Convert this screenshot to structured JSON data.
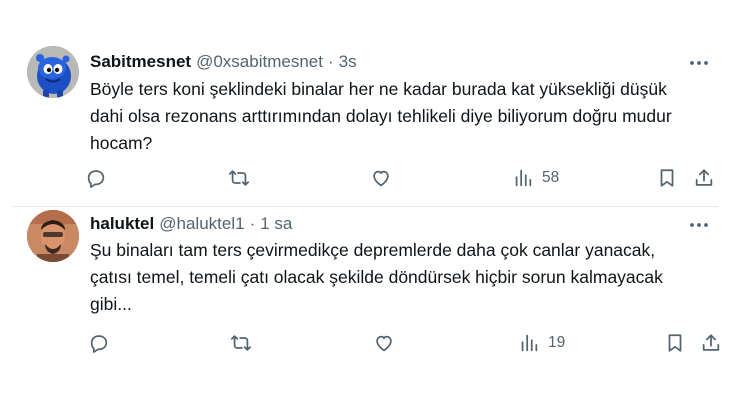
{
  "tweets": [
    {
      "name": "Sabitmesnet",
      "handle": "@0xsabitmesnet",
      "separator": "·",
      "time": "3s",
      "text_lines": [
        "Böyle ters koni şeklindeki binalar her ne kadar burada kat yüksekliği düşük",
        "dahi olsa rezonans arttırımından dolayı tehlikeli diye biliyorum doğru mudur",
        "hocam?"
      ],
      "views": "58",
      "icons": [
        "reply-icon",
        "retweet-icon",
        "like-icon",
        "views-icon",
        "bookmark-icon",
        "share-icon",
        "more-icon"
      ]
    },
    {
      "name": "haluktel",
      "handle": "@haluktel1",
      "separator": "·",
      "time": "1 sa",
      "text_lines": [
        "Şu binaları tam ters çevirmedikçe depremlerde daha çok canlar yanacak,",
        "çatısı temel, temeli çatı olacak şekilde döndürsek hiçbir sorun kalmayacak",
        "gibi..."
      ],
      "views": "19",
      "icons": [
        "reply-icon",
        "retweet-icon",
        "like-icon",
        "views-icon",
        "bookmark-icon",
        "share-icon",
        "more-icon"
      ]
    }
  ],
  "colors": {
    "text": "#0f1419",
    "secondary": "#536471",
    "divider": "#e5e9ec",
    "background": "#ffffff"
  }
}
